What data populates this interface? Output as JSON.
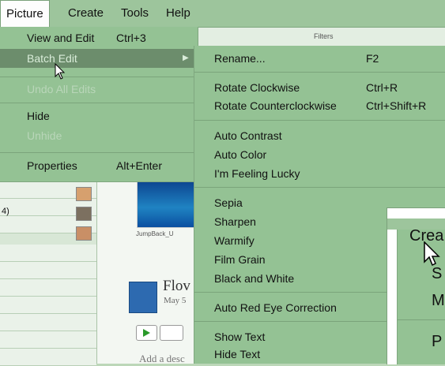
{
  "menubar": {
    "items": [
      "Picture",
      "Create",
      "Tools",
      "Help"
    ],
    "active": "Picture"
  },
  "picture_menu": {
    "view_and_edit": {
      "label": "View and Edit",
      "shortcut": "Ctrl+3"
    },
    "batch_edit": {
      "label": "Batch Edit"
    },
    "undo_all_edits": {
      "label": "Undo All Edits"
    },
    "hide": {
      "label": "Hide"
    },
    "unhide": {
      "label": "Unhide"
    },
    "properties": {
      "label": "Properties",
      "shortcut": "Alt+Enter"
    }
  },
  "batch_submenu": {
    "rename": {
      "label": "Rename...",
      "shortcut": "F2"
    },
    "rotate_cw": {
      "label": "Rotate Clockwise",
      "shortcut": "Ctrl+R"
    },
    "rotate_ccw": {
      "label": "Rotate Counterclockwise",
      "shortcut": "Ctrl+Shift+R"
    },
    "auto_contrast": "Auto Contrast",
    "auto_color": "Auto Color",
    "feeling_lucky": "I'm Feeling Lucky",
    "sepia": "Sepia",
    "sharpen": "Sharpen",
    "warmify": "Warmify",
    "film_grain": "Film Grain",
    "black_and_white": "Black and White",
    "red_eye": "Auto Red Eye Correction",
    "show_text": "Show Text",
    "hide_text": "Hide Text"
  },
  "background": {
    "filters_label": "Filters",
    "count_fragment": "4)",
    "thumb_label": "JumpBack_U",
    "album_title": "Flov",
    "album_date": "May 5",
    "add_description": "Add a desc"
  },
  "inset": {
    "menu_label": "Crea",
    "row1": "S",
    "row2": "M",
    "row3": "P"
  }
}
